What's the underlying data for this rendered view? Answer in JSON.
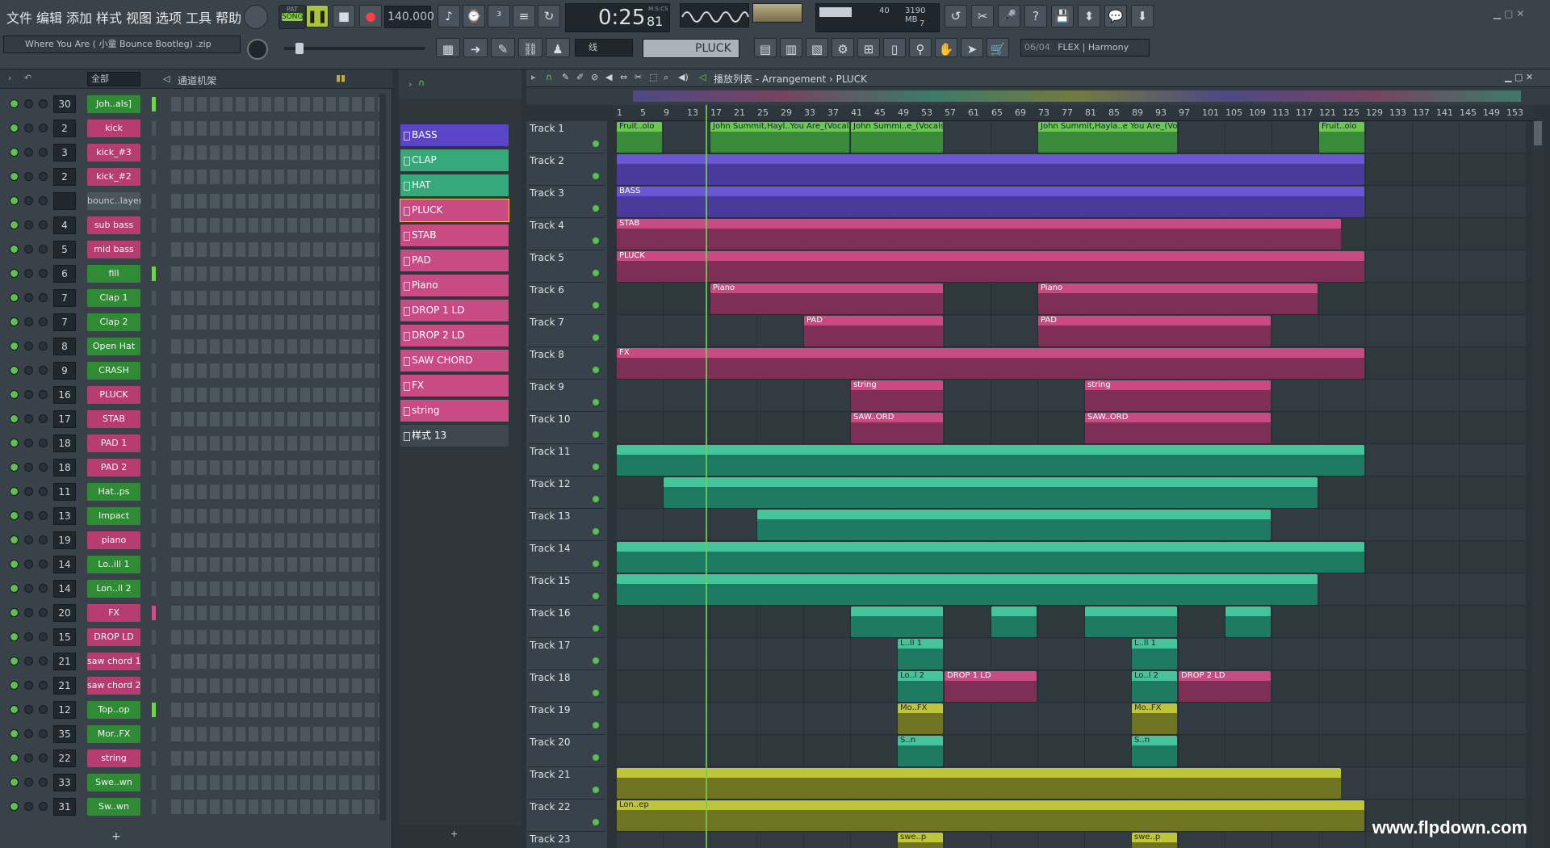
{
  "menu": [
    "文件",
    "编辑",
    "添加",
    "样式",
    "视图",
    "选项",
    "工具",
    "帮助"
  ],
  "transport": {
    "mode": "SONG",
    "mode_alt": "PAT",
    "tempo": "140.000",
    "time": "0:25",
    "time_sub": "81",
    "time_unit": "M:S:CS"
  },
  "monitor": {
    "cpu": "40",
    "memory": "3190 MB",
    "voices": "7"
  },
  "hint_bar": "Where You Are ( 小童 Bounce Bootleg) .zip",
  "snap_label": "线",
  "current_pattern": "PLUCK",
  "plugin_info": {
    "index": "06/04",
    "name": "FLEX | Harmony"
  },
  "rack": {
    "filter": "全部",
    "title": "通道机架"
  },
  "playlist_title": "播放列表 - Arrangement › PLUCK",
  "channels": [
    {
      "num": "30",
      "name": "Joh..als]",
      "color": "g"
    },
    {
      "num": "2",
      "name": "kick",
      "color": "p"
    },
    {
      "num": "3",
      "name": "kick_#3",
      "color": "p"
    },
    {
      "num": "2",
      "name": "kick_#2",
      "color": "p"
    },
    {
      "num": "",
      "name": "bounc..layer",
      "color": "gy"
    },
    {
      "num": "4",
      "name": "sub bass",
      "color": "p"
    },
    {
      "num": "5",
      "name": "mid bass",
      "color": "p"
    },
    {
      "num": "6",
      "name": "fill",
      "color": "g"
    },
    {
      "num": "7",
      "name": "Clap 1",
      "color": "g"
    },
    {
      "num": "7",
      "name": "Clap 2",
      "color": "g"
    },
    {
      "num": "8",
      "name": "Open Hat",
      "color": "g"
    },
    {
      "num": "9",
      "name": "CRASH",
      "color": "g"
    },
    {
      "num": "16",
      "name": "PLUCK",
      "color": "p"
    },
    {
      "num": "17",
      "name": "STAB",
      "color": "p"
    },
    {
      "num": "18",
      "name": "PAD 1",
      "color": "p"
    },
    {
      "num": "18",
      "name": "PAD 2",
      "color": "p"
    },
    {
      "num": "11",
      "name": "Hat..ps",
      "color": "g"
    },
    {
      "num": "13",
      "name": "Impact",
      "color": "g"
    },
    {
      "num": "19",
      "name": "piano",
      "color": "p"
    },
    {
      "num": "14",
      "name": "Lo..ill 1",
      "color": "g"
    },
    {
      "num": "14",
      "name": "Lon..ll 2",
      "color": "g"
    },
    {
      "num": "20",
      "name": "FX",
      "color": "p"
    },
    {
      "num": "15",
      "name": "DROP LD",
      "color": "p"
    },
    {
      "num": "21",
      "name": "saw chord 1",
      "color": "p"
    },
    {
      "num": "21",
      "name": "saw chord 2",
      "color": "p"
    },
    {
      "num": "12",
      "name": "Top..op",
      "color": "g"
    },
    {
      "num": "35",
      "name": "Mor..FX",
      "color": "g"
    },
    {
      "num": "22",
      "name": "string",
      "color": "p"
    },
    {
      "num": "33",
      "name": "Swe..wn",
      "color": "g"
    },
    {
      "num": "31",
      "name": "Sw..wn",
      "color": "g"
    }
  ],
  "patterns": [
    {
      "name": "BASS",
      "color": "#5a45c8"
    },
    {
      "name": "CLAP",
      "color": "#36a87a"
    },
    {
      "name": "HAT",
      "color": "#36a87a"
    },
    {
      "name": "PLUCK",
      "color": "#c84b83"
    },
    {
      "name": "STAB",
      "color": "#c84b83"
    },
    {
      "name": "PAD",
      "color": "#c84b83"
    },
    {
      "name": "Piano",
      "color": "#c84b83"
    },
    {
      "name": "DROP 1 LD",
      "color": "#c84b83"
    },
    {
      "name": "DROP 2 LD",
      "color": "#c84b83"
    },
    {
      "name": "SAW CHORD",
      "color": "#c84b83"
    },
    {
      "name": "FX",
      "color": "#c84b83"
    },
    {
      "name": "string",
      "color": "#c84b83"
    },
    {
      "name": "样式 13",
      "color": "#3e474e"
    }
  ],
  "ruler": [
    "1",
    "5",
    "9",
    "13",
    "17",
    "21",
    "25",
    "29",
    "33",
    "37",
    "41",
    "45",
    "49",
    "53",
    "57",
    "61",
    "65",
    "69",
    "73",
    "77",
    "81",
    "85",
    "89",
    "93",
    "97",
    "101",
    "105",
    "109",
    "113",
    "117",
    "121",
    "125",
    "129",
    "133",
    "137",
    "141",
    "145",
    "149",
    "153"
  ],
  "tracks": [
    "Track 1",
    "Track 2",
    "Track 3",
    "Track 4",
    "Track 5",
    "Track 6",
    "Track 7",
    "Track 8",
    "Track 9",
    "Track 10",
    "Track 11",
    "Track 12",
    "Track 13",
    "Track 14",
    "Track 15",
    "Track 16",
    "Track 17",
    "Track 18",
    "Track 19",
    "Track 20",
    "Track 21",
    "Track 22",
    "Track 23"
  ],
  "clips": [
    {
      "track": 0,
      "start": 0,
      "len": 2,
      "label": "Fruit..olo",
      "style": "grn"
    },
    {
      "track": 0,
      "start": 4,
      "len": 6,
      "label": "John Summit,Hayl..You Are_(Vocals)",
      "style": "grn"
    },
    {
      "track": 0,
      "start": 10,
      "len": 4,
      "label": "John Summi..e_(Vocals)",
      "style": "grn"
    },
    {
      "track": 0,
      "start": 18,
      "len": 6,
      "label": "John Summit,Hayla..e You Are_(Vocals)",
      "style": "grn"
    },
    {
      "track": 0,
      "start": 30,
      "len": 2,
      "label": "Fruit..olo",
      "style": "grn"
    },
    {
      "track": 1,
      "start": 0,
      "len": 32,
      "label": "",
      "style": "pur"
    },
    {
      "track": 2,
      "start": 0,
      "len": 32,
      "label": "BASS",
      "style": "pur"
    },
    {
      "track": 3,
      "start": 0,
      "len": 31,
      "label": "STAB",
      "style": "pnk"
    },
    {
      "track": 4,
      "start": 0,
      "len": 32,
      "label": "PLUCK",
      "style": "pnk"
    },
    {
      "track": 5,
      "start": 4,
      "len": 10,
      "label": "Piano",
      "style": "pnk"
    },
    {
      "track": 5,
      "start": 18,
      "len": 12,
      "label": "Piano",
      "style": "pnk"
    },
    {
      "track": 6,
      "start": 8,
      "len": 6,
      "label": "PAD",
      "style": "pnk"
    },
    {
      "track": 6,
      "start": 18,
      "len": 10,
      "label": "PAD",
      "style": "pnk"
    },
    {
      "track": 7,
      "start": 0,
      "len": 32,
      "label": "FX",
      "style": "pnk"
    },
    {
      "track": 8,
      "start": 10,
      "len": 4,
      "label": "string",
      "style": "pnk"
    },
    {
      "track": 8,
      "start": 20,
      "len": 8,
      "label": "string",
      "style": "pnk"
    },
    {
      "track": 9,
      "start": 10,
      "len": 4,
      "label": "SAW..ORD",
      "style": "pnk"
    },
    {
      "track": 9,
      "start": 20,
      "len": 8,
      "label": "SAW..ORD",
      "style": "pnk"
    },
    {
      "track": 10,
      "start": 0,
      "len": 32,
      "label": "",
      "style": "tea"
    },
    {
      "track": 11,
      "start": 2,
      "len": 28,
      "label": "",
      "style": "tea"
    },
    {
      "track": 12,
      "start": 6,
      "len": 22,
      "label": "",
      "style": "tea"
    },
    {
      "track": 13,
      "start": 0,
      "len": 32,
      "label": "",
      "style": "tea"
    },
    {
      "track": 14,
      "start": 0,
      "len": 30,
      "label": "",
      "style": "tea"
    },
    {
      "track": 15,
      "start": 10,
      "len": 4,
      "label": "",
      "style": "tea"
    },
    {
      "track": 15,
      "start": 16,
      "len": 2,
      "label": "",
      "style": "tea"
    },
    {
      "track": 15,
      "start": 20,
      "len": 4,
      "label": "",
      "style": "tea"
    },
    {
      "track": 15,
      "start": 26,
      "len": 2,
      "label": "",
      "style": "tea"
    },
    {
      "track": 16,
      "start": 12,
      "len": 2,
      "label": "L..ll 1",
      "style": "tea"
    },
    {
      "track": 16,
      "start": 22,
      "len": 2,
      "label": "L..ll 1",
      "style": "tea"
    },
    {
      "track": 17,
      "start": 12,
      "len": 2,
      "label": "Lo..l 2",
      "style": "tea"
    },
    {
      "track": 17,
      "start": 14,
      "len": 4,
      "label": "DROP 1 LD",
      "style": "pnk"
    },
    {
      "track": 17,
      "start": 22,
      "len": 2,
      "label": "Lo..l 2",
      "style": "tea"
    },
    {
      "track": 17,
      "start": 24,
      "len": 4,
      "label": "DROP 2 LD",
      "style": "pnk"
    },
    {
      "track": 18,
      "start": 12,
      "len": 2,
      "label": "Mo..FX",
      "style": "yel"
    },
    {
      "track": 18,
      "start": 22,
      "len": 2,
      "label": "Mo..FX",
      "style": "yel"
    },
    {
      "track": 19,
      "start": 12,
      "len": 2,
      "label": "S..n",
      "style": "tea"
    },
    {
      "track": 19,
      "start": 22,
      "len": 2,
      "label": "S..n",
      "style": "tea"
    },
    {
      "track": 20,
      "start": 0,
      "len": 31,
      "label": "",
      "style": "yel"
    },
    {
      "track": 21,
      "start": 0,
      "len": 32,
      "label": "Lon..ep",
      "style": "yel"
    },
    {
      "track": 22,
      "start": 12,
      "len": 2,
      "label": "swe..p",
      "style": "yel"
    },
    {
      "track": 22,
      "start": 22,
      "len": 2,
      "label": "swe..p",
      "style": "yel"
    }
  ],
  "watermark": "www.flpdown.com",
  "colors": {
    "accent": "#6cc94f",
    "bg": "#2b3238"
  }
}
